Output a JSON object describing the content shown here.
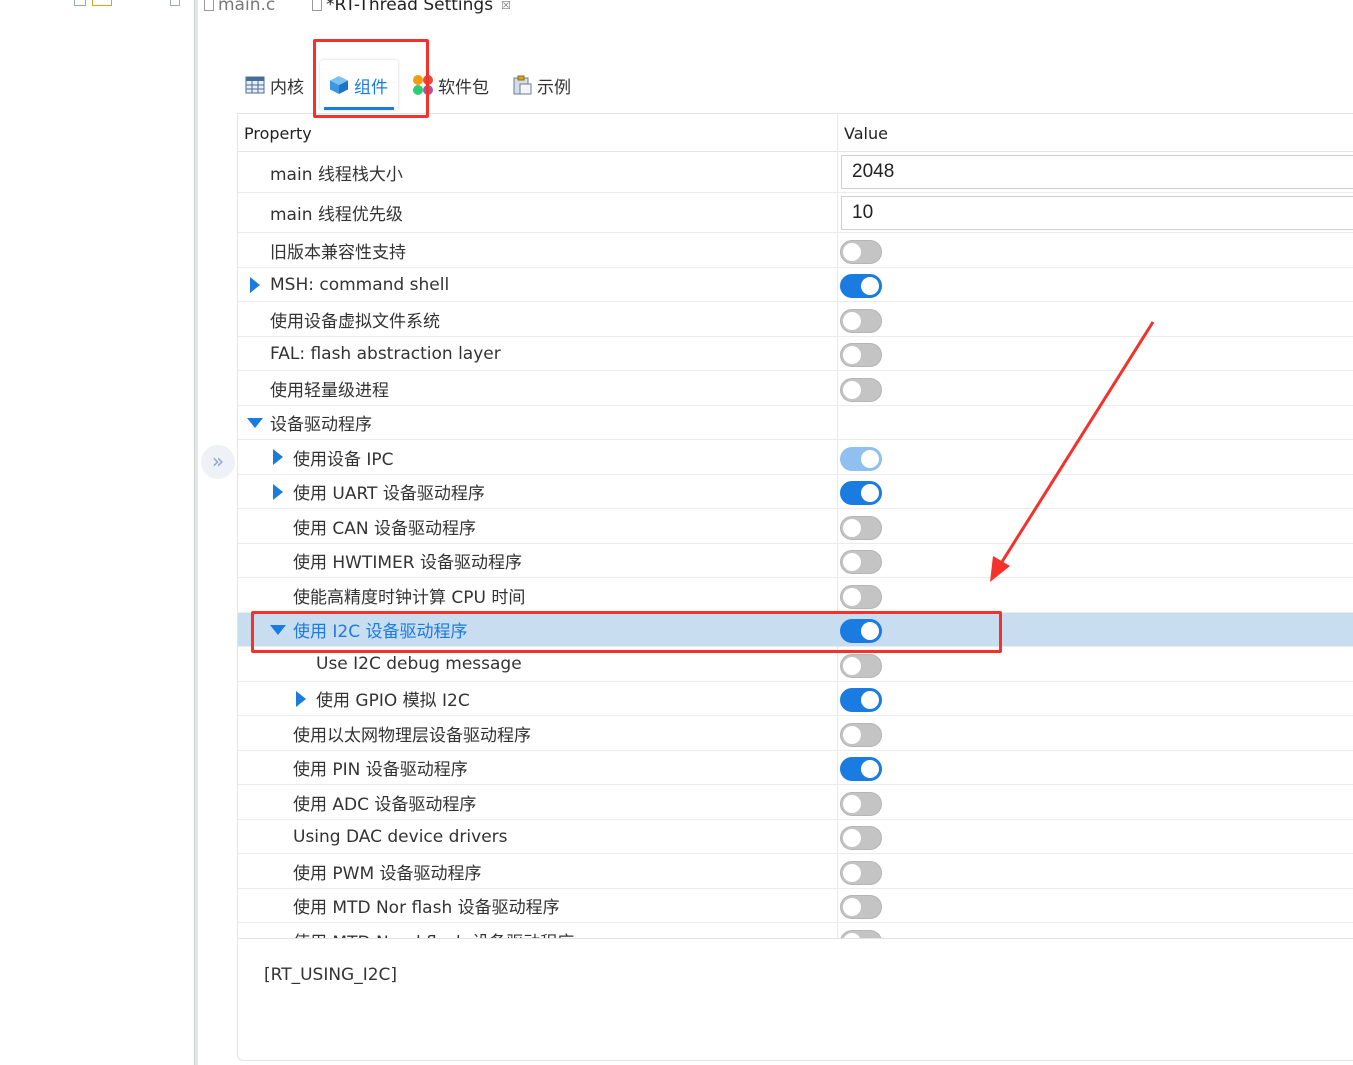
{
  "editor_tabs": [
    {
      "label": "main.c"
    },
    {
      "label": "*RT-Thread Settings",
      "close": "☒"
    }
  ],
  "settings_tabs": [
    {
      "label": "内核",
      "icon": "table-icon"
    },
    {
      "label": "组件",
      "icon": "cube-icon",
      "active": true
    },
    {
      "label": "软件包",
      "icon": "packages-icon"
    },
    {
      "label": "示例",
      "icon": "clipboard-icon"
    }
  ],
  "grid": {
    "col_property": "Property",
    "col_value": "Value",
    "rows": [
      {
        "label": "main 线程栈大小",
        "value": "2048"
      },
      {
        "label": "main 线程优先级",
        "value": "10"
      },
      {
        "label": "旧版本兼容性支持",
        "toggle": "off"
      },
      {
        "label": "MSH: command shell",
        "toggle": "on"
      },
      {
        "label": "使用设备虚拟文件系统",
        "toggle": "off"
      },
      {
        "label": "FAL: flash abstraction layer",
        "toggle": "off"
      },
      {
        "label": "使用轻量级进程",
        "toggle": "off"
      },
      {
        "label": "设备驱动程序"
      },
      {
        "label": "使用设备 IPC",
        "toggle": "on-disabled"
      },
      {
        "label": "使用 UART 设备驱动程序",
        "toggle": "on"
      },
      {
        "label": "使用 CAN 设备驱动程序",
        "toggle": "off"
      },
      {
        "label": "使用 HWTIMER 设备驱动程序",
        "toggle": "off"
      },
      {
        "label": "使能高精度时钟计算 CPU 时间",
        "toggle": "off"
      },
      {
        "label": "使用 I2C 设备驱动程序",
        "toggle": "on",
        "selected": true
      },
      {
        "label": "Use I2C debug message",
        "toggle": "off"
      },
      {
        "label": "使用 GPIO 模拟 I2C",
        "toggle": "on"
      },
      {
        "label": "使用以太网物理层设备驱动程序",
        "toggle": "off"
      },
      {
        "label": "使用 PIN 设备驱动程序",
        "toggle": "on"
      },
      {
        "label": "使用 ADC 设备驱动程序",
        "toggle": "off"
      },
      {
        "label": "Using DAC device drivers",
        "toggle": "off"
      },
      {
        "label": "使用 PWM 设备驱动程序",
        "toggle": "off"
      },
      {
        "label": "使用 MTD Nor flash 设备驱动程序",
        "toggle": "off"
      },
      {
        "label": "使用 MTD Nand flash 设备驱动程序",
        "toggle": "off"
      }
    ]
  },
  "description": "[RT_USING_I2C]",
  "collapse_glyph": "»",
  "colors": {
    "accent": "#1a7be0",
    "annotation": "#f4312a",
    "selected_row": "#c9ddf0"
  }
}
